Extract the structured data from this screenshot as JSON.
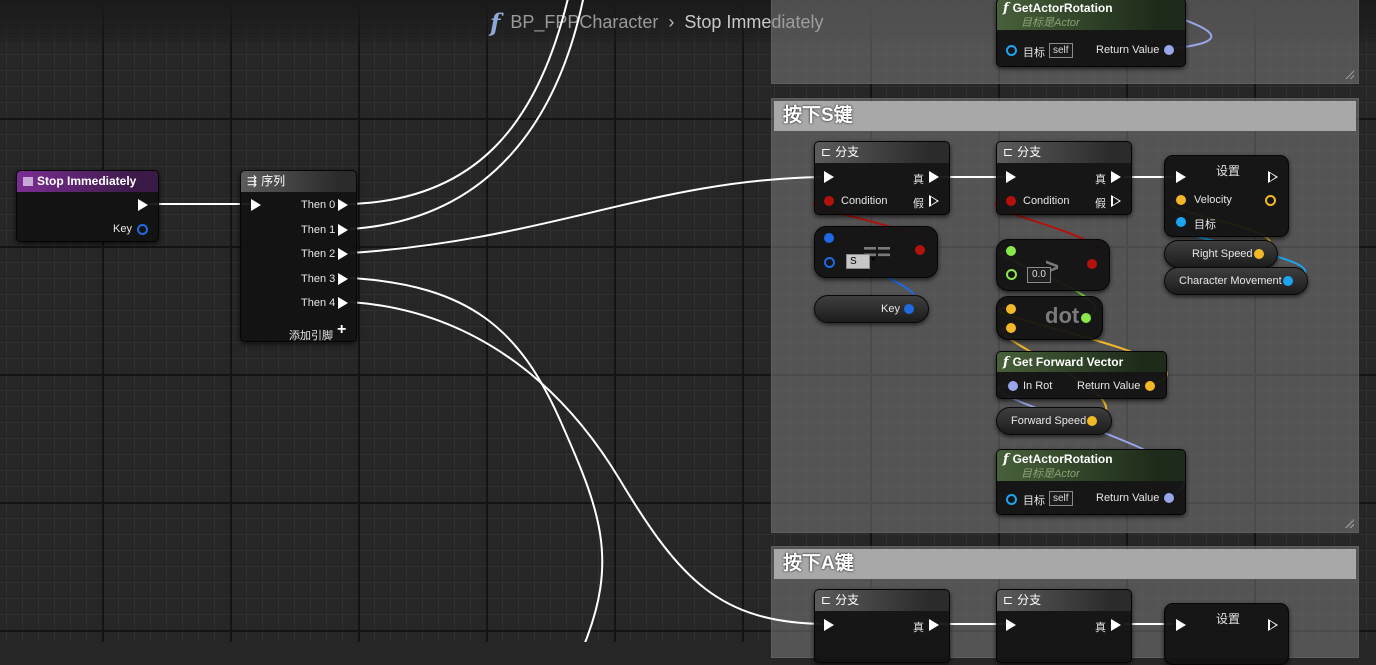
{
  "breadcrumb": {
    "blueprint": "BP_FPPCharacter",
    "function": "Stop Immediately"
  },
  "colors": {
    "exec": "#ffffff",
    "bool": "#b3120c",
    "byte": "#1d6ae2",
    "float": "#8be84a",
    "vector": "#f2b826",
    "rotator": "#9aa6ea",
    "object": "#1ba5f0"
  },
  "entry_node": {
    "title": "Stop Immediately",
    "key_pin": "Key"
  },
  "sequence_node": {
    "title": "序列",
    "pins": [
      "Then 0",
      "Then 1",
      "Then 2",
      "Then 3",
      "Then 4"
    ],
    "add_pin": "添加引脚"
  },
  "top_rotation_node": {
    "title": "GetActorRotation",
    "subtitle": "目标是Actor",
    "target_label": "目标",
    "self_value": "self",
    "return_label": "Return Value"
  },
  "comment_s": {
    "title": "按下S键"
  },
  "comment_a": {
    "title": "按下A键"
  },
  "branch": {
    "title": "分支",
    "condition": "Condition",
    "true_label": "真",
    "false_label": "假"
  },
  "equal_node": {
    "op": "==",
    "key_value": "S"
  },
  "key_var": {
    "label": "Key"
  },
  "greater_node": {
    "op": ">",
    "value": "0.0"
  },
  "dot_node": {
    "op": "dot"
  },
  "forward_vector": {
    "title": "Get Forward Vector",
    "in_label": "In Rot",
    "return_label": "Return Value"
  },
  "forward_speed": {
    "label": "Forward Speed"
  },
  "rotation_node": {
    "title": "GetActorRotation",
    "subtitle": "目标是Actor",
    "target_label": "目标",
    "self_value": "self",
    "return_label": "Return Value"
  },
  "set_node": {
    "title": "设置",
    "velocity": "Velocity",
    "target": "目标"
  },
  "right_speed": {
    "label": "Right Speed"
  },
  "char_movement": {
    "label": "Character Movement"
  }
}
